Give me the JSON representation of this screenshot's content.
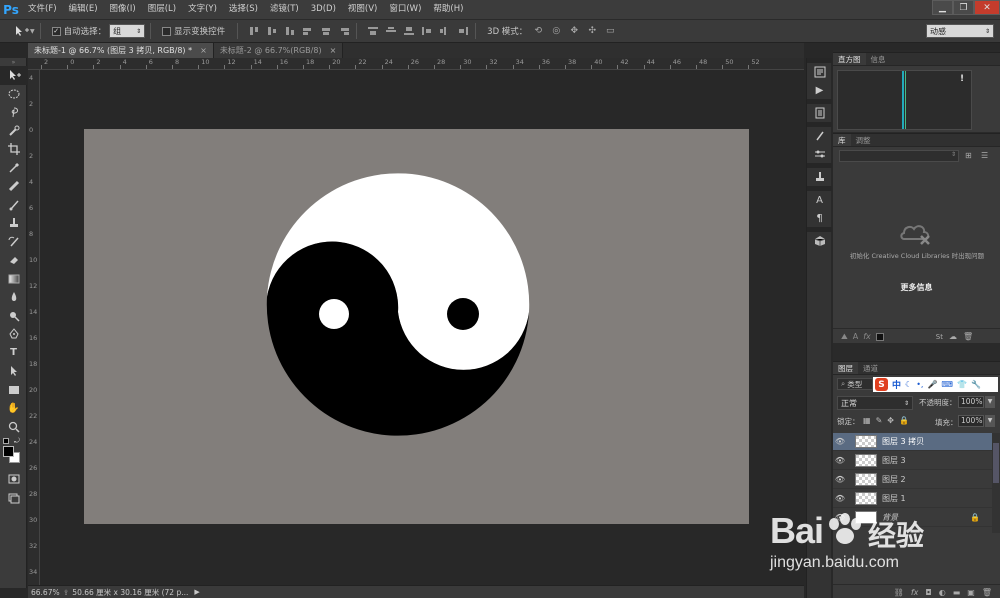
{
  "app": {
    "logo": "Ps"
  },
  "menu": [
    "文件(F)",
    "编辑(E)",
    "图像(I)",
    "图层(L)",
    "文字(Y)",
    "选择(S)",
    "滤镜(T)",
    "3D(D)",
    "视图(V)",
    "窗口(W)",
    "帮助(H)"
  ],
  "window_controls": {
    "minimize": "▁",
    "restore": "❐",
    "close": "✕"
  },
  "options": {
    "auto_select_label": "自动选择：",
    "auto_select_value": "组",
    "show_transform_label": "显示变换控件",
    "mode_3d_label": "3D 模式：",
    "workspace": "动感"
  },
  "tabs": [
    {
      "label": "未标题-1 @ 66.7% (图层 3 拷贝, RGB/8) *",
      "close": "×"
    },
    {
      "label": "未标题-2 @ 66.7%(RGB/8)",
      "close": "×"
    }
  ],
  "ruler": {
    "top": [
      "2",
      "0",
      "2",
      "4",
      "6",
      "8",
      "10",
      "12",
      "14",
      "16",
      "18",
      "20",
      "22",
      "24",
      "26",
      "28",
      "30",
      "32",
      "34",
      "36",
      "38",
      "40",
      "42",
      "44",
      "46",
      "48",
      "50",
      "52"
    ],
    "left": [
      "4",
      "2",
      "0",
      "2",
      "4",
      "6",
      "8",
      "10",
      "12",
      "14",
      "16",
      "18",
      "20",
      "22",
      "24",
      "26",
      "28",
      "30",
      "32",
      "34"
    ]
  },
  "status": {
    "zoom": "66.67%",
    "doc_size": "50.66 厘米 x 30.16 厘米 (72 p..."
  },
  "panels": {
    "histogram": {
      "tabs": [
        "直方图",
        "信息"
      ],
      "warning": "!"
    },
    "library": {
      "tabs": [
        "库",
        "调整"
      ],
      "message": "初始化 Creative Cloud Libraries 时出现问题",
      "more_info": "更多信息"
    },
    "layers": {
      "tabs": [
        "图层",
        "通道"
      ],
      "filter_label": "类型",
      "blend_mode": "正常",
      "opacity_label": "不透明度：",
      "opacity_value": "100%",
      "lock_label": "锁定：",
      "fill_label": "填充：",
      "fill_value": "100%",
      "items": [
        {
          "name": "图层 3 拷贝",
          "selected": true
        },
        {
          "name": "图层 3",
          "selected": false
        },
        {
          "name": "图层 2",
          "selected": false
        },
        {
          "name": "图层 1",
          "selected": false
        },
        {
          "name": "背景",
          "selected": false
        }
      ]
    }
  },
  "ime": {
    "logo": "S",
    "lang": "中"
  },
  "watermark": {
    "brand": "Bai",
    "brand_cn": "经验",
    "url": "jingyan.baidu.com"
  },
  "colors": {
    "canvas_bg": "#827e7b",
    "accent": "#33a6ff",
    "selection": "#5a6b82"
  }
}
